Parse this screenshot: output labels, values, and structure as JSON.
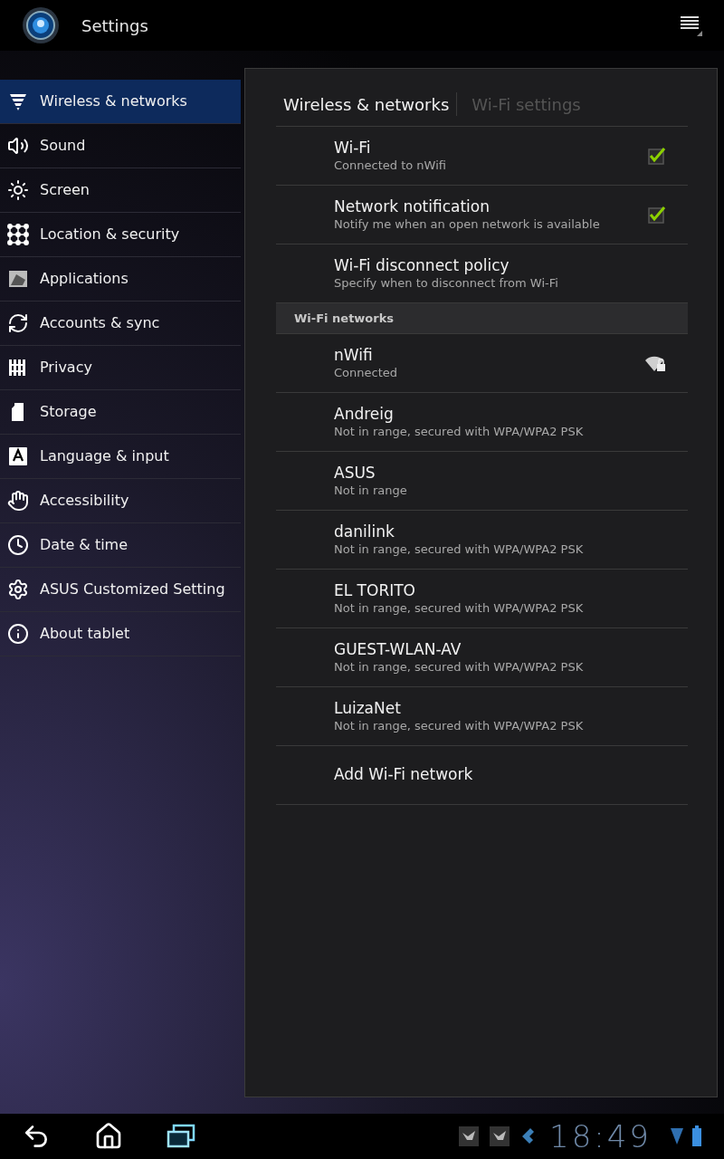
{
  "app_bar": {
    "title": "Settings"
  },
  "sidebar": {
    "items": [
      {
        "label": "Wireless & networks",
        "selected": true
      },
      {
        "label": "Sound",
        "selected": false
      },
      {
        "label": "Screen",
        "selected": false
      },
      {
        "label": "Location & security",
        "selected": false
      },
      {
        "label": "Applications",
        "selected": false
      },
      {
        "label": "Accounts & sync",
        "selected": false
      },
      {
        "label": "Privacy",
        "selected": false
      },
      {
        "label": "Storage",
        "selected": false
      },
      {
        "label": "Language & input",
        "selected": false
      },
      {
        "label": "Accessibility",
        "selected": false
      },
      {
        "label": "Date & time",
        "selected": false
      },
      {
        "label": "ASUS Customized Setting",
        "selected": false
      },
      {
        "label": "About tablet",
        "selected": false
      }
    ]
  },
  "breadcrumb": [
    {
      "label": "Wireless & networks",
      "selected": true
    },
    {
      "label": "Wi-Fi settings",
      "selected": false
    }
  ],
  "preferences": [
    {
      "kind": "checkbox",
      "title": "Wi-Fi",
      "summary": "Connected to nWifi",
      "checked": true
    },
    {
      "kind": "checkbox",
      "title": "Network notification",
      "summary": "Notify me when an open network is available",
      "checked": true
    },
    {
      "kind": "plain",
      "title": "Wi-Fi disconnect policy",
      "summary": "Specify when to disconnect from Wi-Fi"
    }
  ],
  "networks_header": "Wi-Fi networks",
  "networks": [
    {
      "name": "nWifi",
      "status": "Connected",
      "in_range": true
    },
    {
      "name": "Andreig",
      "status": "Not in range, secured with WPA/WPA2 PSK",
      "in_range": false
    },
    {
      "name": "ASUS",
      "status": "Not in range",
      "in_range": false
    },
    {
      "name": "danilink",
      "status": "Not in range, secured with WPA/WPA2 PSK",
      "in_range": false
    },
    {
      "name": "EL TORITO",
      "status": "Not in range, secured with WPA/WPA2 PSK",
      "in_range": false
    },
    {
      "name": "GUEST-WLAN-AV",
      "status": "Not in range, secured with WPA/WPA2 PSK",
      "in_range": false
    },
    {
      "name": "LuizaNet",
      "status": "Not in range, secured with WPA/WPA2 PSK",
      "in_range": false
    }
  ],
  "add_network": "Add Wi-Fi network",
  "status_bar": {
    "time": "18:49"
  }
}
